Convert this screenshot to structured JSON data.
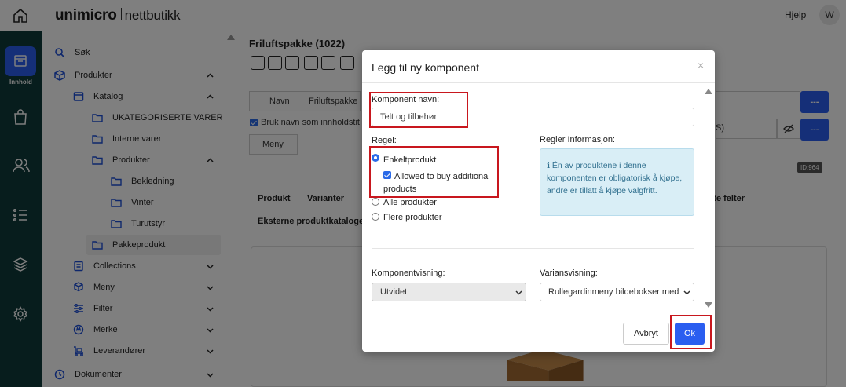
{
  "topbar": {
    "brand": "unimicro",
    "brand_sub": "nettbutikk",
    "help": "Hjelp",
    "avatar": "W"
  },
  "rail": {
    "active_label": "Innhold",
    "items": [
      "content-icon",
      "shopping-bag-icon",
      "users-icon",
      "list-icon",
      "layers-icon",
      "gear-icon"
    ]
  },
  "sidebar": {
    "items": [
      {
        "label": "Søk",
        "icon": "search-icon"
      },
      {
        "label": "Produkter",
        "icon": "cube-icon"
      },
      {
        "label": "Katalog",
        "icon": "catalog-icon"
      },
      {
        "label": "UKATEGORISERTE VARER",
        "icon": "folder-icon"
      },
      {
        "label": "Interne varer",
        "icon": "folder-icon"
      },
      {
        "label": "Produkter",
        "icon": "folder-icon"
      },
      {
        "label": "Bekledning",
        "icon": "folder-icon"
      },
      {
        "label": "Vinter",
        "icon": "folder-icon"
      },
      {
        "label": "Turutstyr",
        "icon": "folder-icon"
      },
      {
        "label": "Pakkeprodukt",
        "icon": "folder-icon"
      },
      {
        "label": "Collections",
        "icon": "collections-icon"
      },
      {
        "label": "Meny",
        "icon": "boxes-icon"
      },
      {
        "label": "Filter",
        "icon": "sliders-icon"
      },
      {
        "label": "Merke",
        "icon": "badge-icon"
      },
      {
        "label": "Leverandører",
        "icon": "truck-icon"
      },
      {
        "label": "Dokumenter",
        "icon": "document-icon"
      }
    ]
  },
  "main": {
    "title": "Friluftspakke (1022)",
    "name_label": "Navn",
    "name_value": "Friluftspakke",
    "use_name_checkbox": "Bruk navn som innholdstit",
    "menu_label": "Meny",
    "more_button": "---",
    "right_field_fragment": "S)",
    "id_badge": "ID:964",
    "tabs": [
      "Produkt",
      "Varianter",
      "rte felter",
      "Eksterne produktkataloger"
    ]
  },
  "modal": {
    "title": "Legg til ny komponent",
    "close": "×",
    "component_name_label": "Komponent navn:",
    "component_name_value": "Telt og tilbehør",
    "rule_label": "Regel:",
    "rule_options": {
      "single": "Enkeltprodukt",
      "allow_additional": "Allowed to buy additional products",
      "all": "Alle produkter",
      "multiple": "Flere produkter"
    },
    "rules_info_label": "Regler Informasjon:",
    "rules_info_icon": "ℹ",
    "rules_info_text": "Én av produktene i denne komponenten er obligatorisk å kjøpe, andre er tillatt å kjøpe valgfritt.",
    "component_view_label": "Komponentvisning:",
    "component_view_value": "Utvidet",
    "variant_view_label": "Variansvisning:",
    "variant_view_value": "Rullegardinmeny bildebokser med",
    "cancel": "Avbryt",
    "ok": "Ok"
  },
  "colors": {
    "primary": "#2a5ef0",
    "rail": "#0f3a3a",
    "highlight": "#c8171e",
    "info_bg": "#d9eef6"
  }
}
